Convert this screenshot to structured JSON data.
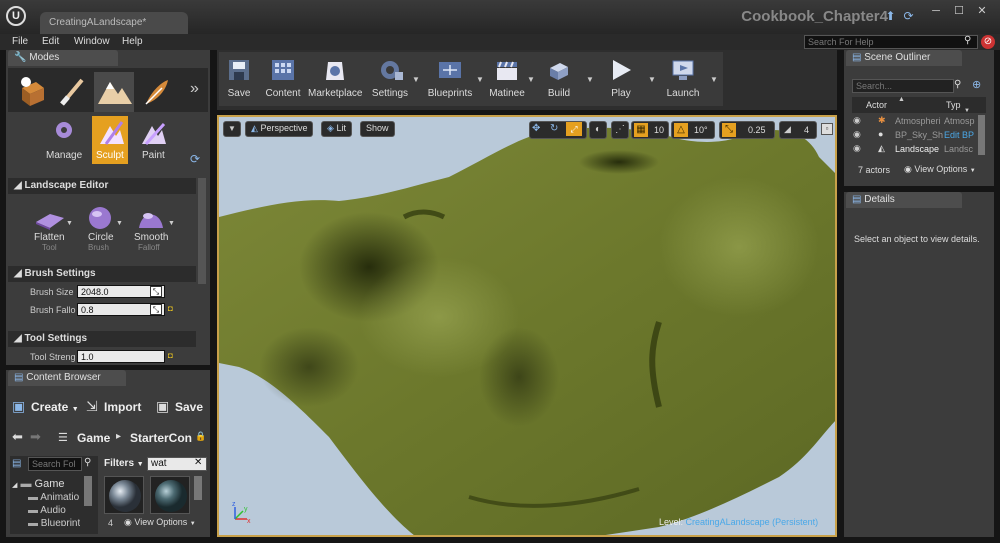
{
  "window": {
    "tab_title": "CreatingALandscape*",
    "project_name": "Cookbook_Chapter4"
  },
  "menu": [
    "File",
    "Edit",
    "Window",
    "Help"
  ],
  "help_search": {
    "placeholder": "Search For Help"
  },
  "modes": {
    "tab_label": "Modes",
    "submodes": [
      "Manage",
      "Sculpt",
      "Paint"
    ],
    "active_submode": "Sculpt"
  },
  "landscape_editor": {
    "header": "Landscape Editor",
    "tools": [
      {
        "name": "Flatten",
        "sub": "Tool"
      },
      {
        "name": "Circle",
        "sub": "Brush"
      },
      {
        "name": "Smooth",
        "sub": "Falloff"
      }
    ],
    "brush_settings": {
      "header": "Brush Settings",
      "brush_size_label": "Brush Size",
      "brush_size": "2048.0",
      "brush_falloff_label": "Brush Fallo",
      "brush_falloff": "0.8"
    },
    "tool_settings": {
      "header": "Tool Settings",
      "tool_strength_label": "Tool Streng",
      "tool_strength": "1.0"
    }
  },
  "toolbar": {
    "buttons": [
      "Save",
      "Content",
      "Marketplace",
      "Settings",
      "Blueprints",
      "Matinee",
      "Build",
      "Play",
      "Launch"
    ]
  },
  "viewport": {
    "perspective_label": "Perspective",
    "lit_label": "Lit",
    "show_label": "Show",
    "grid_snap": "10",
    "rotation_snap": "10°",
    "scale_snap": "0.25",
    "camera_speed": "4",
    "level_label": "Level:",
    "level_name": "CreatingALandscape (Persistent)"
  },
  "content_browser": {
    "tab_label": "Content Browser",
    "create_label": "Create",
    "import_label": "Import",
    "save_label": "Save",
    "path": [
      "Game",
      "StarterCon"
    ],
    "folder_search_placeholder": "Search Fol",
    "filters_label": "Filters",
    "search_value": "wat",
    "folders": [
      "Game",
      "Animatio",
      "Audio",
      "Blueprint"
    ],
    "item_count": "4",
    "view_options": "View Options"
  },
  "scene_outliner": {
    "tab_label": "Scene Outliner",
    "search_placeholder": "Search...",
    "col_actor": "Actor",
    "col_type": "Typ",
    "rows": [
      {
        "name": "Atmospheri",
        "type": "Atmosp"
      },
      {
        "name": "BP_Sky_Sh",
        "type": "Edit BP"
      },
      {
        "name": "Landscape",
        "type": "Landsc"
      }
    ],
    "actor_count": "7 actors",
    "view_options": "View Options"
  },
  "details": {
    "tab_label": "Details",
    "empty_message": "Select an object to view details."
  },
  "colors": {
    "accent_orange": "#e5a020",
    "viewport_border": "#c8a14a",
    "terrain": "#6f7a2e",
    "sky": "#b9c9d9",
    "level_name_blue": "#4aa8e8"
  }
}
